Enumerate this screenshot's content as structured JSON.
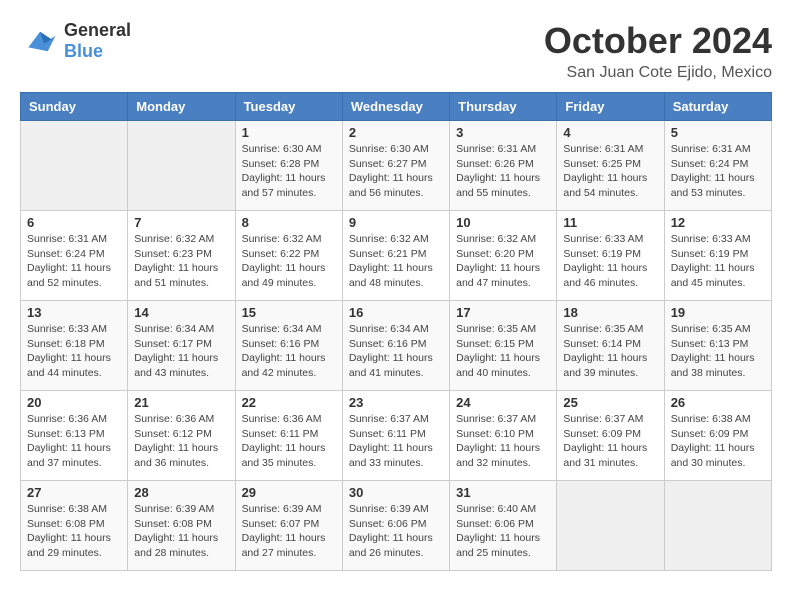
{
  "logo": {
    "line1": "General",
    "line2": "Blue"
  },
  "title": "October 2024",
  "location": "San Juan Cote Ejido, Mexico",
  "days_of_week": [
    "Sunday",
    "Monday",
    "Tuesday",
    "Wednesday",
    "Thursday",
    "Friday",
    "Saturday"
  ],
  "weeks": [
    [
      {
        "day": "",
        "info": ""
      },
      {
        "day": "",
        "info": ""
      },
      {
        "day": "1",
        "sunrise": "6:30 AM",
        "sunset": "6:28 PM",
        "daylight": "11 hours and 57 minutes."
      },
      {
        "day": "2",
        "sunrise": "6:30 AM",
        "sunset": "6:27 PM",
        "daylight": "11 hours and 56 minutes."
      },
      {
        "day": "3",
        "sunrise": "6:31 AM",
        "sunset": "6:26 PM",
        "daylight": "11 hours and 55 minutes."
      },
      {
        "day": "4",
        "sunrise": "6:31 AM",
        "sunset": "6:25 PM",
        "daylight": "11 hours and 54 minutes."
      },
      {
        "day": "5",
        "sunrise": "6:31 AM",
        "sunset": "6:24 PM",
        "daylight": "11 hours and 53 minutes."
      }
    ],
    [
      {
        "day": "6",
        "sunrise": "6:31 AM",
        "sunset": "6:24 PM",
        "daylight": "11 hours and 52 minutes."
      },
      {
        "day": "7",
        "sunrise": "6:32 AM",
        "sunset": "6:23 PM",
        "daylight": "11 hours and 51 minutes."
      },
      {
        "day": "8",
        "sunrise": "6:32 AM",
        "sunset": "6:22 PM",
        "daylight": "11 hours and 49 minutes."
      },
      {
        "day": "9",
        "sunrise": "6:32 AM",
        "sunset": "6:21 PM",
        "daylight": "11 hours and 48 minutes."
      },
      {
        "day": "10",
        "sunrise": "6:32 AM",
        "sunset": "6:20 PM",
        "daylight": "11 hours and 47 minutes."
      },
      {
        "day": "11",
        "sunrise": "6:33 AM",
        "sunset": "6:19 PM",
        "daylight": "11 hours and 46 minutes."
      },
      {
        "day": "12",
        "sunrise": "6:33 AM",
        "sunset": "6:19 PM",
        "daylight": "11 hours and 45 minutes."
      }
    ],
    [
      {
        "day": "13",
        "sunrise": "6:33 AM",
        "sunset": "6:18 PM",
        "daylight": "11 hours and 44 minutes."
      },
      {
        "day": "14",
        "sunrise": "6:34 AM",
        "sunset": "6:17 PM",
        "daylight": "11 hours and 43 minutes."
      },
      {
        "day": "15",
        "sunrise": "6:34 AM",
        "sunset": "6:16 PM",
        "daylight": "11 hours and 42 minutes."
      },
      {
        "day": "16",
        "sunrise": "6:34 AM",
        "sunset": "6:16 PM",
        "daylight": "11 hours and 41 minutes."
      },
      {
        "day": "17",
        "sunrise": "6:35 AM",
        "sunset": "6:15 PM",
        "daylight": "11 hours and 40 minutes."
      },
      {
        "day": "18",
        "sunrise": "6:35 AM",
        "sunset": "6:14 PM",
        "daylight": "11 hours and 39 minutes."
      },
      {
        "day": "19",
        "sunrise": "6:35 AM",
        "sunset": "6:13 PM",
        "daylight": "11 hours and 38 minutes."
      }
    ],
    [
      {
        "day": "20",
        "sunrise": "6:36 AM",
        "sunset": "6:13 PM",
        "daylight": "11 hours and 37 minutes."
      },
      {
        "day": "21",
        "sunrise": "6:36 AM",
        "sunset": "6:12 PM",
        "daylight": "11 hours and 36 minutes."
      },
      {
        "day": "22",
        "sunrise": "6:36 AM",
        "sunset": "6:11 PM",
        "daylight": "11 hours and 35 minutes."
      },
      {
        "day": "23",
        "sunrise": "6:37 AM",
        "sunset": "6:11 PM",
        "daylight": "11 hours and 33 minutes."
      },
      {
        "day": "24",
        "sunrise": "6:37 AM",
        "sunset": "6:10 PM",
        "daylight": "11 hours and 32 minutes."
      },
      {
        "day": "25",
        "sunrise": "6:37 AM",
        "sunset": "6:09 PM",
        "daylight": "11 hours and 31 minutes."
      },
      {
        "day": "26",
        "sunrise": "6:38 AM",
        "sunset": "6:09 PM",
        "daylight": "11 hours and 30 minutes."
      }
    ],
    [
      {
        "day": "27",
        "sunrise": "6:38 AM",
        "sunset": "6:08 PM",
        "daylight": "11 hours and 29 minutes."
      },
      {
        "day": "28",
        "sunrise": "6:39 AM",
        "sunset": "6:08 PM",
        "daylight": "11 hours and 28 minutes."
      },
      {
        "day": "29",
        "sunrise": "6:39 AM",
        "sunset": "6:07 PM",
        "daylight": "11 hours and 27 minutes."
      },
      {
        "day": "30",
        "sunrise": "6:39 AM",
        "sunset": "6:06 PM",
        "daylight": "11 hours and 26 minutes."
      },
      {
        "day": "31",
        "sunrise": "6:40 AM",
        "sunset": "6:06 PM",
        "daylight": "11 hours and 25 minutes."
      },
      {
        "day": "",
        "info": ""
      },
      {
        "day": "",
        "info": ""
      }
    ]
  ]
}
